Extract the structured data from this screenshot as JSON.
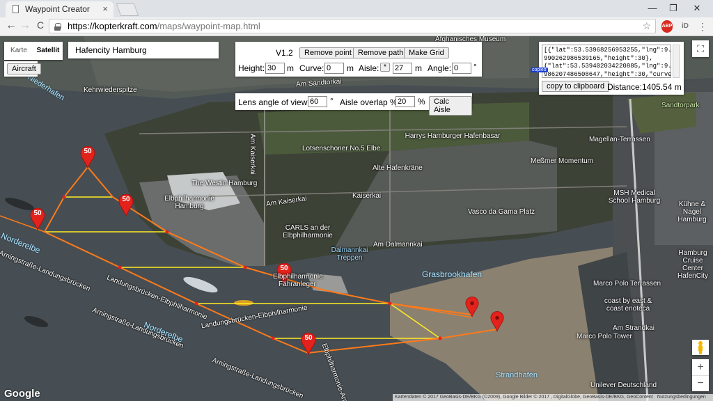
{
  "browser": {
    "tab_title": "Waypoint Creator",
    "tab_close": "×",
    "url_host": "https://kopterkraft.com",
    "url_path": "/maps/waypoint-map.html",
    "back": "←",
    "forward": "→",
    "reload": "C",
    "minimize": "—",
    "maximize": "❐",
    "close": "✕",
    "star": "☆",
    "abp": "ABP",
    "ext_id": "iD",
    "menu": "⋮"
  },
  "map_type": {
    "karte": "Karte",
    "satellit": "Satellit"
  },
  "aircraft_button": "Aircraft",
  "search": {
    "value": "Hafencity Hamburg"
  },
  "controls": {
    "version": "V1.2",
    "remove_point": "Remove point",
    "remove_path": "Remove path",
    "make_grid": "Make Grid",
    "height_label": "Height:",
    "height_value": "30",
    "height_unit": "m",
    "curve_label": "Curve:",
    "curve_value": "0",
    "curve_unit": "m",
    "aisle_label": "Aisle:",
    "aisle_button": "*",
    "aisle_value": "27",
    "aisle_unit": "m",
    "angle_label": "Angle:",
    "angle_value": "0",
    "angle_unit": "°",
    "lens_label": "Lens angle of view:",
    "lens_value": "60",
    "lens_unit": "°",
    "overlap_label": "Aisle overlap %:",
    "overlap_value": "20",
    "overlap_unit": "%",
    "calc_aisle": "Calc Aisle"
  },
  "json_output": {
    "line1": "[{\"lat\":53.53968256953255,\"lng\":9.",
    "line2": "990262986539165,\"height\":30},",
    "line3": "{\"lat\":53.539402034220885,\"lng\":9.",
    "line4": "986207486508647,\"height\":30,\"curve",
    "copied_badge": "copied",
    "copy_button": "copy to clipboard",
    "distance_label": "Distance:",
    "distance_value": "1405.54 m"
  },
  "markers": {
    "label1": "50",
    "label2": "50",
    "label3": "50",
    "label4": "50",
    "label5": "50"
  },
  "map_labels": {
    "afghanisches": "Afghanisches Museum",
    "kehrwieder": "Kehrwiederspitze",
    "niederhafen": "Niederhafen",
    "am_sandtorkai": "Am Sandtorkai",
    "sandtorpark": "Sandtorpark",
    "harrys": "Harrys Hamburger Hafenbasar",
    "lotsenschoner": "Lotsenschoner No.5 Elbe",
    "magellan": "Magellan-Terrassen",
    "westin": "The Westin Hamburg",
    "elbphil": "Elbphilharmonie Hamburg",
    "am_kaiserkai": "Am Kaiserkai",
    "alte_hafen": "Alte Hafenkräne",
    "messmer": "Meßmer Momentum",
    "kaiserkai": "Kaiserkai",
    "vasco": "Vasco da Gama Platz",
    "msh": "MSH Medical School Hamburg",
    "kuehne": "Kühne & Nagel Hamburg",
    "carls": "CARLS an der Elbphilharmonie",
    "dalmannkai": "Dalmannkai Treppen",
    "am_dalmannkai": "Am Dalmannkai",
    "grasbrookhafen": "Grasbrookhafen",
    "hamburg_cruise": "Hamburg Cruise Center HafenCity",
    "norderelbe1": "Norderelbe",
    "norderelbe2": "Norderelbe",
    "landungsbruecken1": "Arningstraße-Landungsbrücken",
    "landungsbruecken2": "Landungsbrücken-Elbphilharmonie",
    "landungsbruecken3": "Landungsbrücken-Elbphilharmonie",
    "arningstrasse": "Arningstraße-Landungsbrücken",
    "arningstrasse2": "Arningstraße-Landungsbrücken",
    "elbphil_anleger": "Elbphilharmonie Fähranleger",
    "marco_polo": "Marco Polo Terrassen",
    "coast": "coast by east & coast enoteca",
    "am_strandkai": "Am Strandkai",
    "marco_tower": "Marco Polo Tower",
    "strandhafen": "Strandhafen",
    "unilever": "Unilever Deutschland",
    "am_kaiserkai_v": "Am Kaiserkai",
    "elbphil_arn": "Elbphilharmonie-Arning..."
  },
  "footer": {
    "google": "Google",
    "attribution": "Kartendaten © 2017 GeoBasis-DE/BKG (©2009), Google Bilder © 2017 , DigitalGlobe, GeoBasis-DE/BKG, GeoContent",
    "terms": "Nutzungsbedingungen"
  },
  "zoom": {
    "plus": "+",
    "minus": "−",
    "fullscreen": "⛶"
  },
  "colors": {
    "path_orange": "#ff7a1a",
    "grid_yellow": "#ffee22",
    "marker_red": "#e3221b"
  }
}
